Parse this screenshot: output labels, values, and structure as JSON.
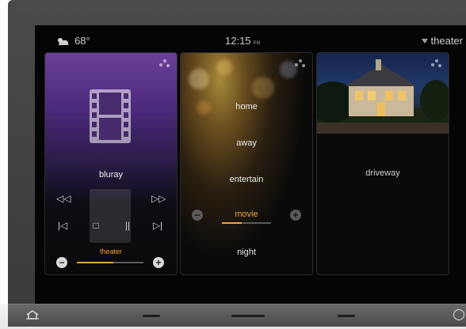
{
  "status": {
    "weather_icon": "partly-cloudy-icon",
    "temperature": "68°",
    "time": "12:15",
    "ampm": "PM",
    "room": "theater"
  },
  "media_card": {
    "source": "bluray",
    "volume_zone": "theater",
    "volume_level_fraction": 0.55,
    "controls": [
      "rewind",
      "fast-forward",
      "skip-previous",
      "stop",
      "pause",
      "skip-next"
    ],
    "accent_color": "#f1a33b"
  },
  "scenes_card": {
    "modes": [
      "home",
      "away",
      "entertain",
      "movie",
      "night"
    ],
    "active_mode": "movie",
    "active_level_fraction": 0.4
  },
  "camera_card": {
    "camera_name": "driveway"
  },
  "hardware": {
    "home_icon": "home-icon",
    "power_icon": "power-icon"
  }
}
